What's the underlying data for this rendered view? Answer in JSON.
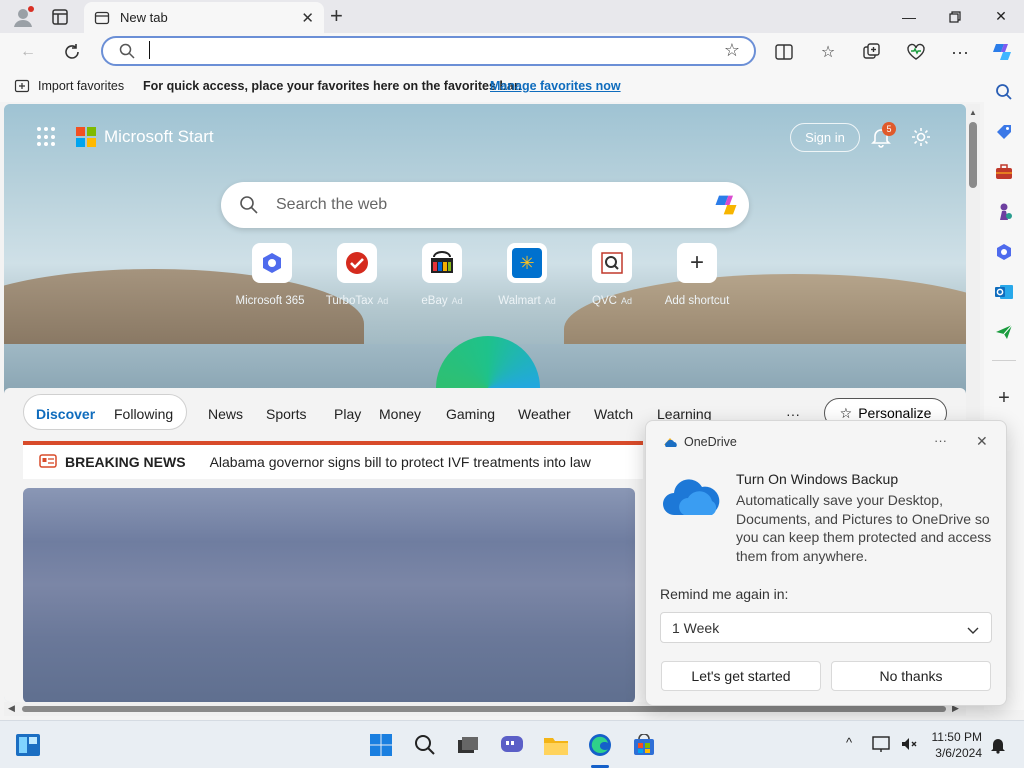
{
  "browser": {
    "tab_title": "New tab",
    "address_value": "",
    "favbar": {
      "import_label": "Import favorites",
      "message": "For quick access, place your favorites here on the favorites bar.",
      "manage_link": "Manage favorites now"
    }
  },
  "start": {
    "brand": "Microsoft Start",
    "sign_in": "Sign in",
    "notification_count": "5",
    "search_placeholder": "Search the web",
    "tiles": [
      {
        "label": "Microsoft 365",
        "ad": ""
      },
      {
        "label": "TurboTax",
        "ad": "Ad"
      },
      {
        "label": "eBay",
        "ad": "Ad"
      },
      {
        "label": "Walmart",
        "ad": "Ad"
      },
      {
        "label": "QVC",
        "ad": "Ad"
      },
      {
        "label": "Add shortcut",
        "ad": ""
      }
    ],
    "nav": {
      "discover": "Discover",
      "following": "Following",
      "news": "News",
      "sports": "Sports",
      "play": "Play",
      "money": "Money",
      "gaming": "Gaming",
      "weather": "Weather",
      "watch": "Watch",
      "learning": "Learning",
      "more": "···",
      "personalize": "Personalize"
    },
    "breaking": {
      "label": "BREAKING NEWS",
      "headline": "Alabama governor signs bill to protect IVF treatments into law"
    }
  },
  "onedrive": {
    "app": "OneDrive",
    "more": "···",
    "title": "Turn On Windows Backup",
    "body": "Automatically save your Desktop, Documents, and Pictures to OneDrive so you can keep them protected and access them from anywhere.",
    "remind_label": "Remind me again in:",
    "remind_value": "1 Week",
    "primary": "Let's get started",
    "secondary": "No thanks"
  },
  "taskbar": {
    "time": "11:50 PM",
    "date": "3/6/2024"
  },
  "colors": {
    "accent": "#0f6cbd",
    "breaking_red": "#d84b2a",
    "notification_badge": "#e05a2b"
  }
}
